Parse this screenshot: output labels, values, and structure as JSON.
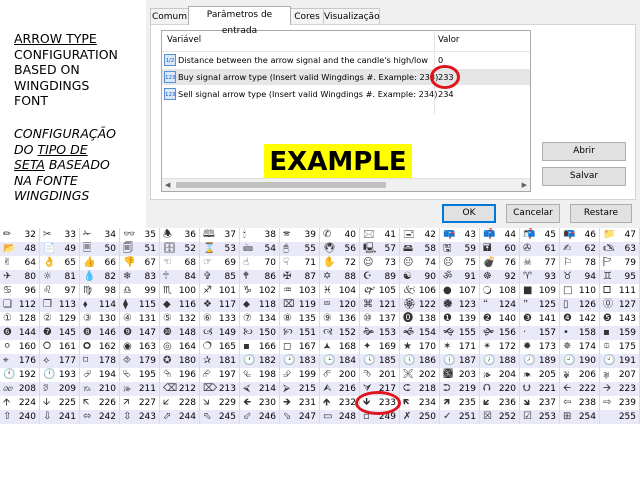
{
  "note": {
    "en_title": "ARROW TYPE",
    "en_rest": [
      "CONFIGURATION",
      "BASED ON",
      "WINGDINGS",
      "FONT"
    ],
    "pt_line1": "CONFIGURAÇÃO",
    "pt_line2_plain": "DO ",
    "pt_line2_u": "TIPO DE",
    "pt_line3_u": "SETA",
    "pt_line3_plain": " BASEADO",
    "pt_line4": "NA FONTE",
    "pt_line5": "WINGDINGS"
  },
  "dialog": {
    "tabs": [
      "Comum",
      "Parâmetros de entrada",
      "Cores",
      "Visualização"
    ],
    "active_tab": 1,
    "columns": {
      "variable": "Variável",
      "value": "Valor"
    },
    "params": [
      {
        "icon": "1/2",
        "name": "Distance between the arrow signal and the candle's high/low",
        "value": "0"
      },
      {
        "icon": "123",
        "name": "Buy signal arrow type (Insert valid Wingdings #. Example: 233)",
        "value": "233"
      },
      {
        "icon": "123",
        "name": "Sell signal arrow type (Insert valid Wingdings #. Example: 234)",
        "value": "234"
      }
    ],
    "selected_param": 1,
    "example_label": "EXAMPLE",
    "buttons": {
      "open": "Abrir",
      "save": "Salvar",
      "ok": "OK",
      "cancel": "Cancelar",
      "reset": "Restare"
    }
  },
  "wingdings": {
    "symbols": "✏✂✁👓🕭🕮🕯🕿✆🖂🖃📪📫📬📭📁📂📄🗏🗐🗄⌛🖮🖰🖲🖳🖴🖫🖬✇✍🖎✌👌👍👎☜☞☝☟✋☺😐☹💣☠⚐🏱✈☼💧❄🕆✞🕈✠✡☪☯ॐ☸♈♉♊♋♌♍♎♏♐♑♒♓🙰🙵●🔾■□🞐❑❒⬧⧫◆❖⬥⌧⮹⌘🏵🏶🙶🙷▯⓪①②③④⑤⑥⑦⑧⑨⑩⓿❶❷❸❹❺❻❼❽❾❿🙢🙠🙡🙣🙞🙜🙝🙟·•▪⚪🞆🞈◉◎🔿▪◻🟂✦★✶✴✹✵⯐⌖⟡⌑⯑✪✰🕐🕑🕒🕓🕔🕕🕖🕗🕘🕙🕚🕛⮰⮱⮲⮳⮴⮵⮶⮷🙪🙫🙕🙔🙗🙖🙐🙑🙒🙓⌫⌦⮘⮚⮙⮛⮈⮊⮉⮋🡨🡪🡩🡫🡬🡭🡯🡮🡸🡺🡹🡻🡼🡽🡿🡾⇦⇨⇧⇩⬄⇳⬀⬁⬃⬂▭▫✗✓☒☑⊞",
    "start": 32,
    "end": 255,
    "columns": 16,
    "highlight": 233
  },
  "colors": {
    "highlight_ring": "#e0141e",
    "example_bg": "#ffff00",
    "row_alt": "#e9e9f8"
  }
}
